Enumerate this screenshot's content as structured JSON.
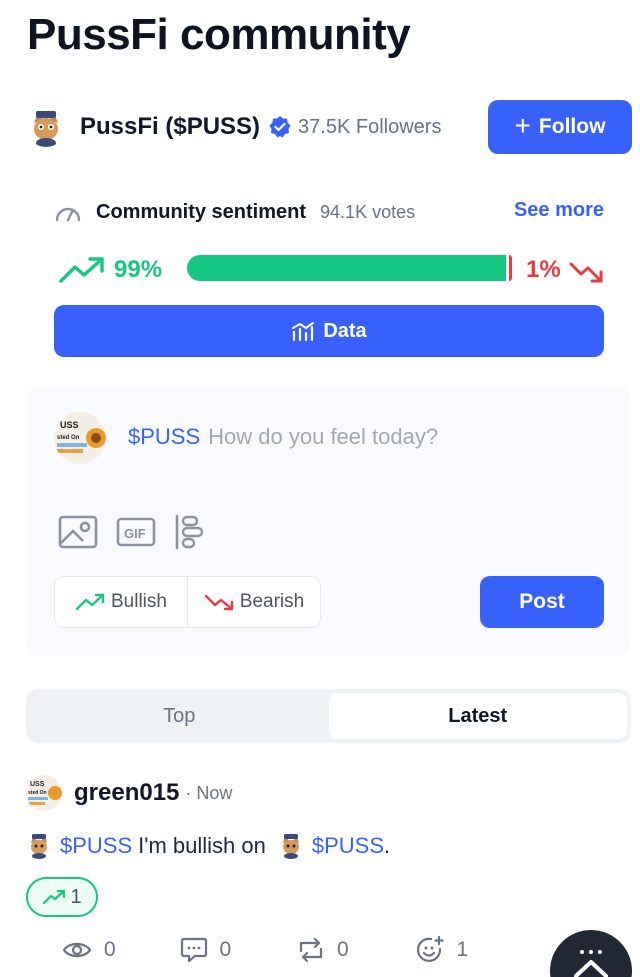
{
  "page": {
    "title": "PussFi community"
  },
  "token": {
    "name": "PussFi ($PUSS)",
    "followers": "37.5K Followers",
    "follow_label": "Follow"
  },
  "sentiment": {
    "label": "Community sentiment",
    "votes": "94.1K votes",
    "see_more": "See more",
    "bullish_pct": "99%",
    "bearish_pct": "1%",
    "bullish_fraction": 0.99,
    "data_label": "Data"
  },
  "composer": {
    "ticker": "$PUSS",
    "placeholder": "How do you feel today?",
    "bullish_label": "Bullish",
    "bearish_label": "Bearish",
    "post_label": "Post",
    "tools": [
      "image-icon",
      "gif-icon",
      "poll-icon"
    ]
  },
  "tabs": [
    {
      "label": "Top",
      "active": false
    },
    {
      "label": "Latest",
      "active": true
    }
  ],
  "post": {
    "username": "green015",
    "time": "· Now",
    "ticker1": "$PUSS",
    "text_mid": "I'm bullish on",
    "ticker2": "$PUSS",
    "text_end": ".",
    "bullish_count": "1",
    "views": "0",
    "comments": "0",
    "reposts": "0",
    "reactions": "1"
  },
  "colors": {
    "accent": "#3861fb",
    "bull": "#16c784",
    "bear": "#ea3943"
  }
}
